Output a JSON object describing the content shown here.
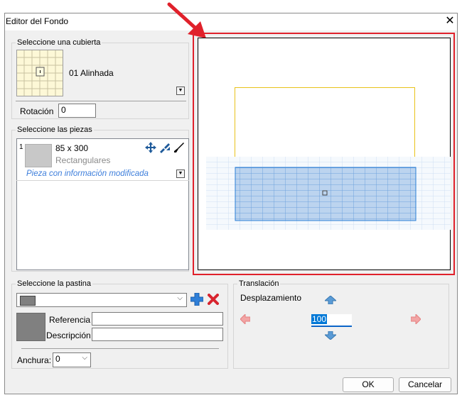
{
  "window": {
    "title": "Editor del Fondo"
  },
  "cubierta": {
    "group_label": "Seleccione una cubierta",
    "name": "01 Alinhada"
  },
  "rotacion": {
    "label": "Rotación",
    "value": "0"
  },
  "piezas": {
    "group_label": "Seleccione las piezas",
    "items": [
      {
        "index": "1",
        "size": "85 x 300",
        "type": "Rectangulares",
        "note": "Pieza con información modificada"
      }
    ]
  },
  "pastina": {
    "group_label": "Seleccione la pastina",
    "referencia_label": "Referencia",
    "descripcion_label": "Descripción",
    "referencia_value": "",
    "descripcion_value": "",
    "swatch_color": "#808080"
  },
  "anchura": {
    "label": "Anchura:",
    "value": "0"
  },
  "traslacion": {
    "group_label": "Translación",
    "desplazamiento_label": "Desplazamiento",
    "value": "100"
  },
  "buttons": {
    "ok": "OK",
    "cancel": "Cancelar"
  },
  "colors": {
    "highlight_red": "#e0212b",
    "outline_yellow": "#e8c21a",
    "tiles_blue": "#2b7fd6"
  }
}
